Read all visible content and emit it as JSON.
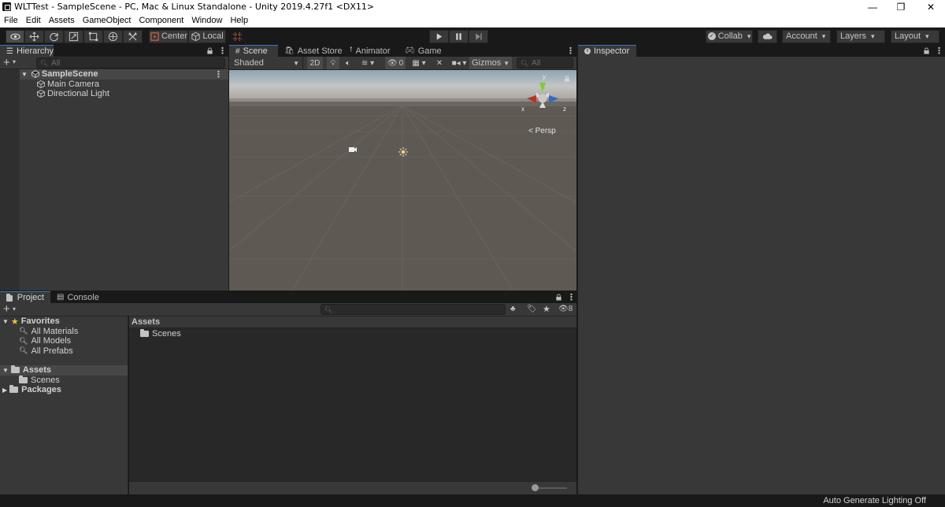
{
  "window": {
    "title": "WLTTest - SampleScene - PC, Mac & Linux Standalone - Unity 2019.4.27f1 <DX11>",
    "minimize": "—",
    "restore": "❐",
    "close": "✕"
  },
  "menu": [
    "File",
    "Edit",
    "Assets",
    "GameObject",
    "Component",
    "Window",
    "Help"
  ],
  "toolbar": {
    "pivot_label": "Center",
    "space_label": "Local",
    "collab_label": "Collab",
    "account_label": "Account",
    "layers_label": "Layers",
    "layout_label": "Layout"
  },
  "hierarchy": {
    "tab_label": "Hierarchy",
    "search_placeholder": "All",
    "scene_name": "SampleScene",
    "objects": [
      "Main Camera",
      "Directional Light"
    ]
  },
  "scene_view": {
    "tabs": [
      "Scene",
      "Asset Store",
      "Animator",
      "Game"
    ],
    "shading_mode": "Shaded",
    "mode_2d": "2D",
    "hidden_count": "0",
    "gizmos_label": "Gizmos",
    "search_placeholder": "All",
    "persp_label": "Persp",
    "axis_x": "x",
    "axis_y": "y",
    "axis_z": "z"
  },
  "inspector": {
    "tab_label": "Inspector"
  },
  "project": {
    "tabs": [
      "Project",
      "Console"
    ],
    "hidden_count": "8",
    "favorites_label": "Favorites",
    "favorites": [
      "All Materials",
      "All Models",
      "All Prefabs"
    ],
    "assets_label": "Assets",
    "asset_folders": [
      "Scenes"
    ],
    "packages_label": "Packages",
    "breadcrumb": "Assets",
    "contents": [
      "Scenes"
    ]
  },
  "statusbar": {
    "text": "Auto Generate Lighting Off"
  },
  "colors": {
    "accent": "#3a79bb",
    "panel": "#383838",
    "panel_dark": "#282828",
    "toolbar": "#191919",
    "sky": "#aeb4b8",
    "ground": "#5f5954"
  },
  "icons": [
    "view-tool-icon",
    "move-tool-icon",
    "rotate-tool-icon",
    "scale-tool-icon",
    "rect-tool-icon",
    "transform-tool-icon",
    "custom-tool-icon",
    "play-icon",
    "pause-icon",
    "step-icon",
    "cloud-icon",
    "lock-icon",
    "kebab-menu-icon"
  ]
}
